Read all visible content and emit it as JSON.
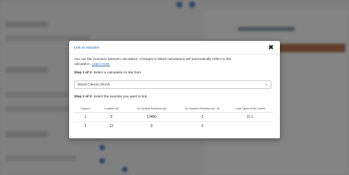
{
  "modal": {
    "title": "Link to reaction",
    "close_icon": "close-icon",
    "description": "You can link reactions between calculators. Changes in linked calculations will automatically reflect in this calculation.",
    "learn_more": "Learn more.",
    "step1_prefix": "Step 1 of 2:",
    "step1_text": " Select a calculation to link from",
    "select_value": "Wood Column (Roof)",
    "step2_prefix": "Step 2 of 2:",
    "step2_text": " Select the reaction you want to link",
    "table": {
      "headers": [
        "Support",
        "Location (ft)",
        "UL Vertical Reaction (lb)",
        "UL Moment Reaction (lb - ft)",
        "Load Types to Be Linked"
      ],
      "rows": [
        [
          "1",
          "0",
          "12400",
          "0",
          "D, L"
        ],
        [
          "2",
          "12",
          "0",
          "0",
          ""
        ]
      ]
    }
  }
}
